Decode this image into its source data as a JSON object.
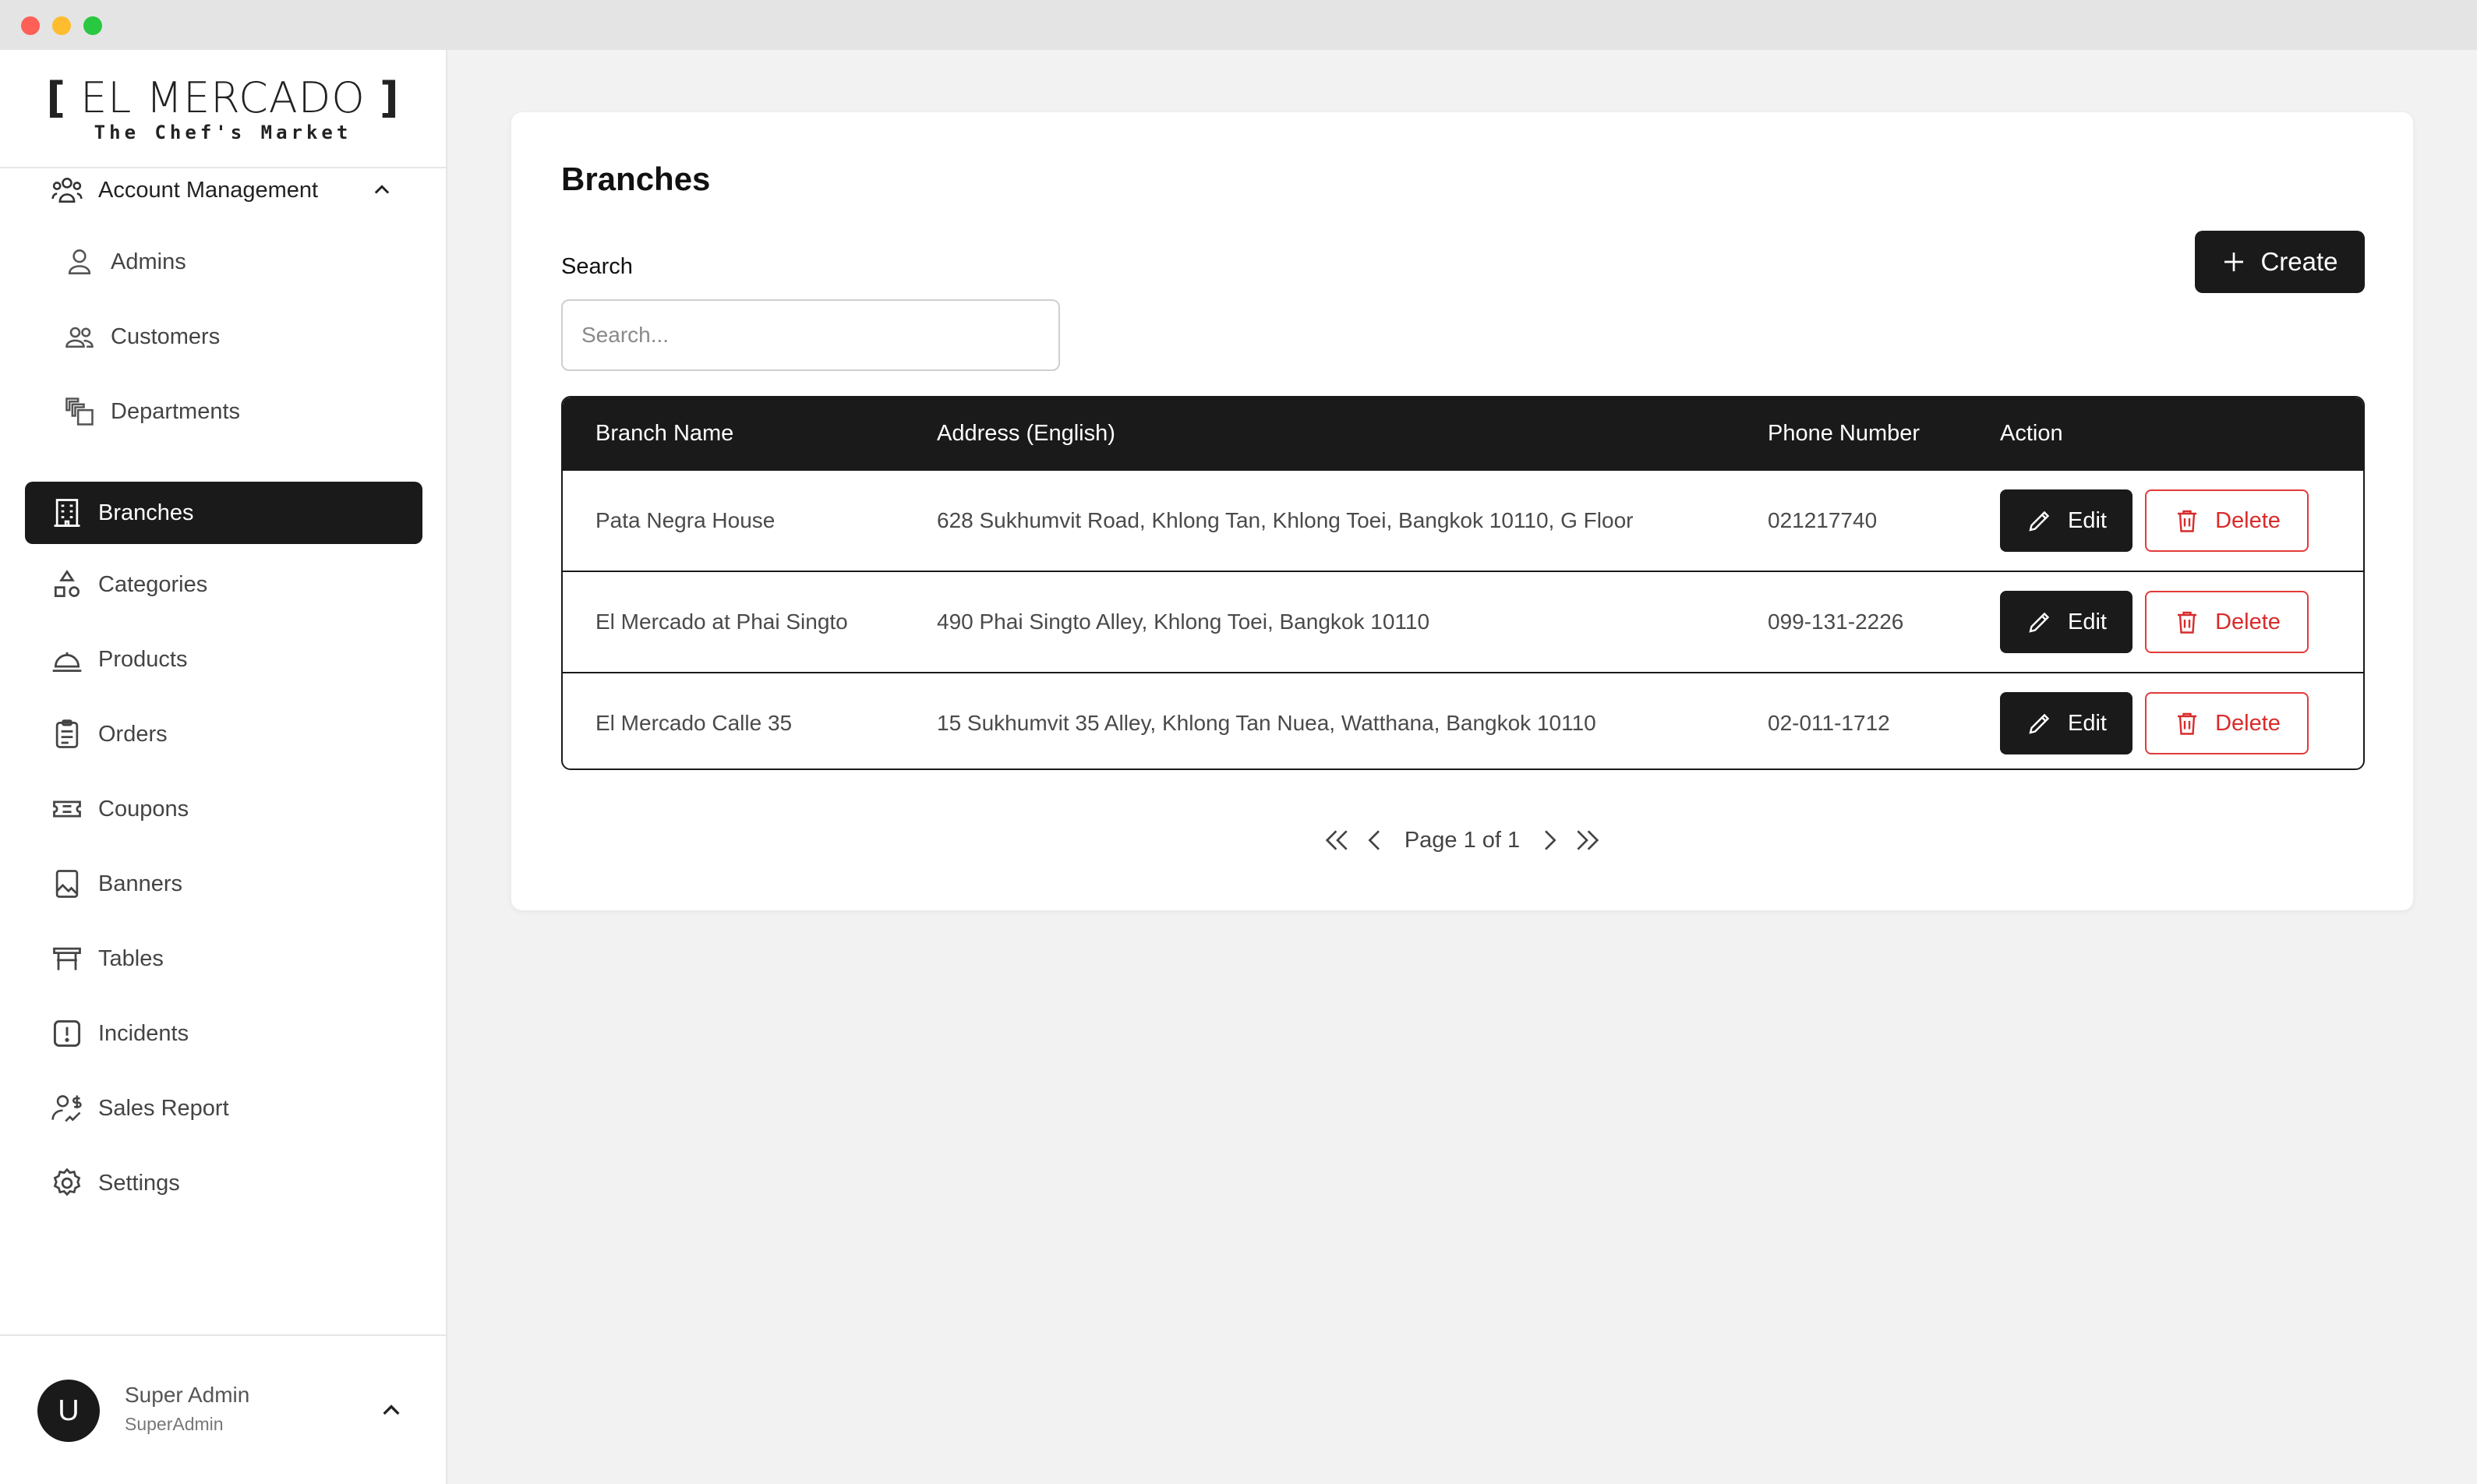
{
  "brand": {
    "name": "EL MERCADO",
    "tagline": "The Chef's Market"
  },
  "sidebar": {
    "group": {
      "label": "Account Management",
      "icon": "users-group-icon"
    },
    "sub_items": [
      {
        "label": "Admins",
        "icon": "user-icon"
      },
      {
        "label": "Customers",
        "icon": "users-icon"
      },
      {
        "label": "Departments",
        "icon": "departments-icon"
      }
    ],
    "active_item": {
      "label": "Branches",
      "icon": "building-icon"
    },
    "items": [
      {
        "label": "Categories",
        "icon": "shapes-icon"
      },
      {
        "label": "Products",
        "icon": "cloche-icon"
      },
      {
        "label": "Orders",
        "icon": "clipboard-icon"
      },
      {
        "label": "Coupons",
        "icon": "ticket-icon"
      },
      {
        "label": "Banners",
        "icon": "image-icon"
      },
      {
        "label": "Tables",
        "icon": "table-icon"
      },
      {
        "label": "Incidents",
        "icon": "alert-icon"
      },
      {
        "label": "Sales Report",
        "icon": "sales-icon"
      },
      {
        "label": "Settings",
        "icon": "gear-icon"
      }
    ]
  },
  "user": {
    "initial": "U",
    "name": "Super Admin",
    "role": "SuperAdmin"
  },
  "main": {
    "title": "Branches",
    "search": {
      "label": "Search",
      "placeholder": "Search..."
    },
    "create_label": "Create",
    "table": {
      "columns": [
        "Branch Name",
        "Address (English)",
        "Phone Number",
        "Action"
      ],
      "rows": [
        {
          "name": "Pata Negra House",
          "address": "628 Sukhumvit Road, Khlong Tan, Khlong Toei, Bangkok 10110, G Floor",
          "phone": "021217740"
        },
        {
          "name": "El Mercado at Phai Singto",
          "address": "490 Phai Singto Alley, Khlong Toei, Bangkok 10110",
          "phone": "099-131-2226"
        },
        {
          "name": "El Mercado Calle 35",
          "address": "15 Sukhumvit 35 Alley, Khlong Tan Nuea, Watthana, Bangkok 10110",
          "phone": "02-011-1712"
        }
      ],
      "edit_label": "Edit",
      "delete_label": "Delete"
    },
    "pagination": {
      "text": "Page 1 of 1"
    }
  },
  "colors": {
    "primary": "#1a1a1a",
    "danger": "#d92b2b",
    "background": "#f2f2f2"
  }
}
